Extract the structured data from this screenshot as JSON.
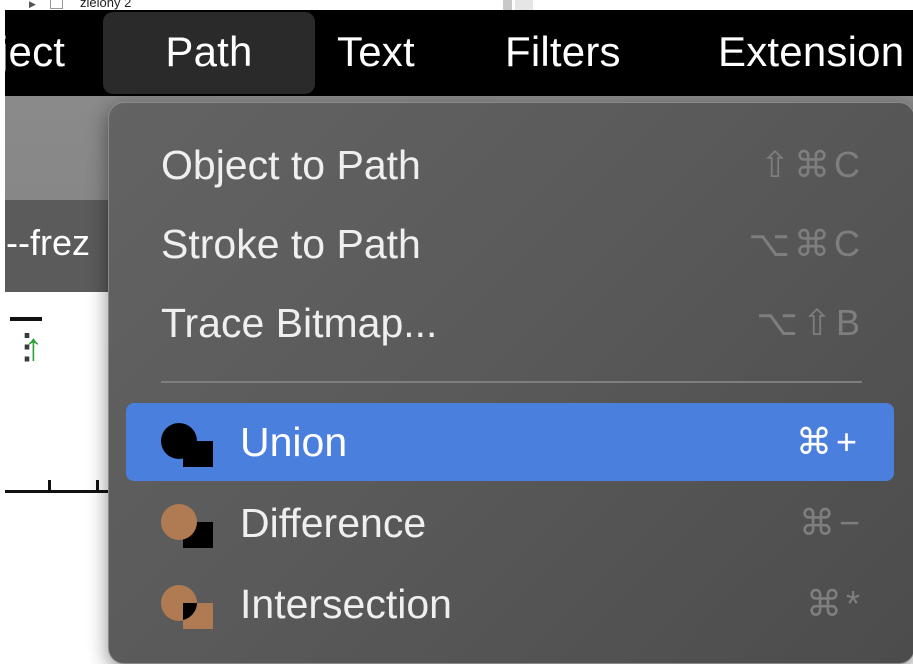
{
  "layers_panel": {
    "item_label": "zielony 2"
  },
  "menubar": {
    "items": [
      {
        "label": "ject"
      },
      {
        "label": "Path"
      },
      {
        "label": "Text"
      },
      {
        "label": "Filters"
      },
      {
        "label": "Extension"
      }
    ]
  },
  "document_tab": {
    "label": "--frez"
  },
  "path_menu": {
    "items": [
      {
        "label": "Object to Path",
        "shortcut": "⇧⌘C",
        "icon": ""
      },
      {
        "label": "Stroke to Path",
        "shortcut": "⌥⌘C",
        "icon": ""
      },
      {
        "label": "Trace Bitmap...",
        "shortcut": "⌥⇧B",
        "icon": ""
      },
      {
        "label": "Union",
        "shortcut": "⌘+",
        "icon": "union-icon"
      },
      {
        "label": "Difference",
        "shortcut": "⌘−",
        "icon": "difference-icon"
      },
      {
        "label": "Intersection",
        "shortcut": "⌘*",
        "icon": "intersection-icon"
      }
    ]
  },
  "colors": {
    "highlight": "#4a7fde",
    "menubar": "#000000",
    "icon_orange": "#b07b52",
    "ruler_arrow": "#2fa037"
  }
}
